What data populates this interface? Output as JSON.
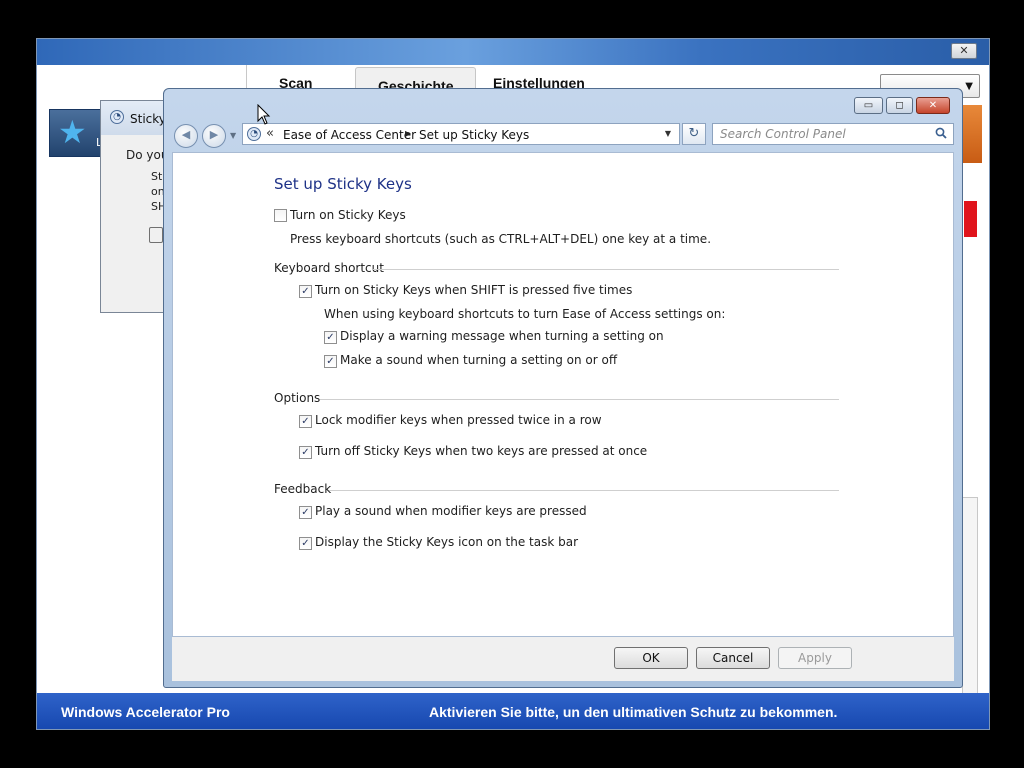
{
  "background_app": {
    "tabs": [
      "Scan",
      "Geschichte",
      "Einstellungen"
    ],
    "selected_tab": "Geschichte",
    "close_label": "✕",
    "status_left": "Windows Accelerator Pro",
    "status_right": "Aktivieren Sie bitte, un den ultimativen Schutz zu bekommen."
  },
  "sticky_prompt": {
    "title": "Sticky",
    "question": "Do you",
    "lines": [
      "Sti",
      "on",
      "SH"
    ]
  },
  "control_panel": {
    "caption_buttons": {
      "minimize": "▭",
      "maximize": "◻",
      "close": "✕"
    },
    "address": {
      "overflow": "«",
      "crumbs": [
        "Ease of Access Center",
        "Set up Sticky Keys"
      ]
    },
    "search_placeholder": "Search Control Panel",
    "title": "Set up Sticky Keys",
    "main_option": {
      "label": "Turn on Sticky Keys",
      "checked": false,
      "description": "Press keyboard shortcuts (such as CTRL+ALT+DEL) one key at a time."
    },
    "keyboard_shortcut": {
      "heading": "Keyboard shortcut",
      "toggle": {
        "label": "Turn on Sticky Keys when SHIFT is pressed five times",
        "checked": true
      },
      "note": "When using keyboard shortcuts to turn Ease of Access settings on:",
      "warning": {
        "label": "Display a warning message when turning a setting on",
        "checked": true
      },
      "sound": {
        "label": "Make a sound when turning a setting on or off",
        "checked": true
      }
    },
    "options": {
      "heading": "Options",
      "lock": {
        "label": "Lock modifier keys when pressed twice in a row",
        "checked": true
      },
      "turn_off": {
        "label": "Turn off Sticky Keys when two keys are pressed at once",
        "checked": true
      }
    },
    "feedback": {
      "heading": "Feedback",
      "play_sound": {
        "label": "Play a sound when modifier keys are pressed",
        "checked": true
      },
      "taskbar_icon": {
        "label": "Display the Sticky Keys icon on the task bar",
        "checked": true
      }
    },
    "buttons": {
      "ok": "OK",
      "cancel": "Cancel",
      "apply": "Apply"
    }
  },
  "icons": {
    "check_mark": "✓",
    "breadcrumb_separator": "▶",
    "dropdown": "▼",
    "refresh": "↻",
    "back": "◀",
    "forward": "▶"
  }
}
